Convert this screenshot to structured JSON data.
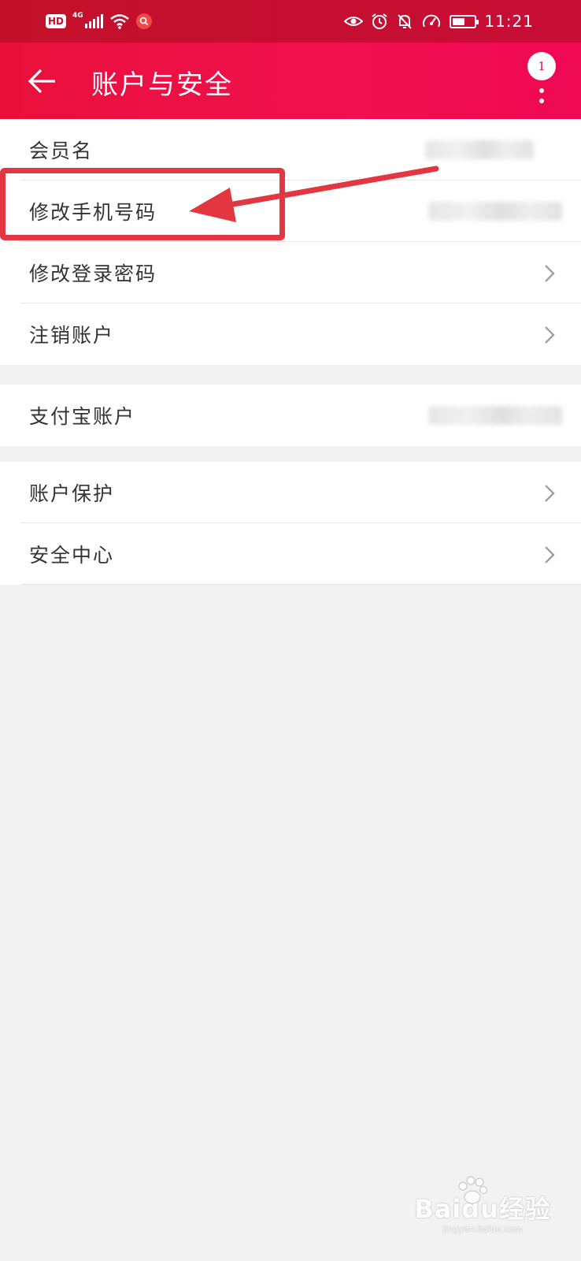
{
  "status_bar": {
    "hd_label": "HD",
    "network_type": "4G",
    "time": "11:21",
    "battery_level": 0.55,
    "icons": [
      "hd-badge",
      "signal-icon",
      "wifi-icon",
      "app-search-icon",
      "eye-icon",
      "alarm-icon",
      "bell-off-icon",
      "speed-icon",
      "battery-icon"
    ]
  },
  "header": {
    "title": "账户与安全",
    "notification_count": "1",
    "back_icon": "arrow-left-icon",
    "more_icon": "more-vertical-icon",
    "gradient_colors": [
      "#e8103a",
      "#ef0854"
    ]
  },
  "groups": [
    {
      "rows": [
        {
          "label": "会员名",
          "value": "",
          "value_blurred": true,
          "chevron": false
        },
        {
          "label": "修改手机号码",
          "value": "",
          "value_blurred": true,
          "chevron": false
        },
        {
          "label": "修改登录密码",
          "chevron": true
        },
        {
          "label": "注销账户",
          "chevron": true
        }
      ]
    },
    {
      "rows": [
        {
          "label": "支付宝账户",
          "value": "",
          "value_blurred": true,
          "chevron": false
        }
      ]
    },
    {
      "rows": [
        {
          "label": "账户保护",
          "chevron": true
        },
        {
          "label": "安全中心",
          "chevron": true
        }
      ]
    }
  ],
  "annotation": {
    "color": "#e23640",
    "target": "修改手机号码"
  },
  "watermark": {
    "logo": "Baidu经验",
    "sub": "jingyan.baidu.com"
  },
  "colors": {
    "background": "#f2f2f2",
    "text": "#333333",
    "chevron": "#a0a0a0"
  }
}
